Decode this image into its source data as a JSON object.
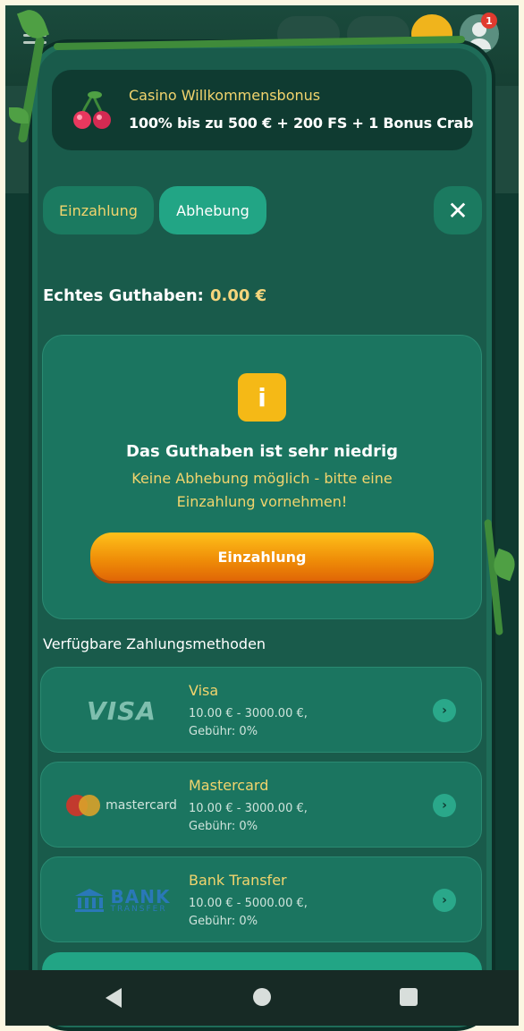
{
  "header": {
    "notification_count": "1"
  },
  "bonus": {
    "title": "Casino Willkommensbonus",
    "subtitle": "100% bis zu 500 € + 200 FS + 1 Bonus Crab"
  },
  "tabs": [
    {
      "label": "Einzahlung",
      "active": false
    },
    {
      "label": "Abhebung",
      "active": true
    }
  ],
  "close_label": "✕",
  "balance": {
    "label": "Echtes Guthaben:",
    "value": "0.00 €"
  },
  "notice": {
    "icon_text": "i",
    "title": "Das Guthaben ist sehr niedrig",
    "line1": "Keine Abhebung möglich - bitte eine",
    "line2": "Einzahlung vornehmen!",
    "button_label": "Einzahlung"
  },
  "methods": {
    "title": "Verfügbare Zahlungsmethoden",
    "items": [
      {
        "name": "Visa",
        "logo_text": "VISA",
        "range": "10.00 € - 3000.00 €,",
        "fee": "Gebühr: 0%"
      },
      {
        "name": "Mastercard",
        "logo_text": "mastercard",
        "range": "10.00 € - 3000.00 €,",
        "fee": "Gebühr: 0%"
      },
      {
        "name": "Bank Transfer",
        "logo_text": "BANK",
        "logo_subtext": "TRANSFER",
        "range": "10.00 € - 5000.00 €,",
        "fee": "Gebühr: 0%"
      }
    ]
  },
  "colors": {
    "accent_gold": "#f2d46d",
    "modal_green": "#195b4b",
    "button_orange": "#ee8a07",
    "active_tab": "#22a585"
  }
}
